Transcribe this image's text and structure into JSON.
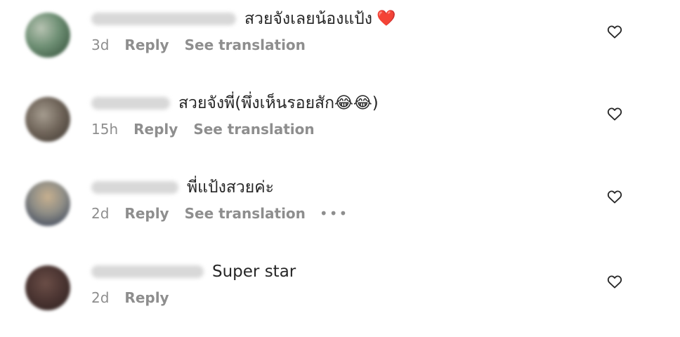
{
  "comments": [
    {
      "username_redacted": true,
      "text": "สวยจังเลยน้องแป้ง",
      "emoji": "❤️",
      "time": "3d",
      "reply": "Reply",
      "translation": "See translation",
      "has_more": false
    },
    {
      "username_redacted": true,
      "text": "สวยจังพี่(พึ่งเห็นรอยสัก😂😂)",
      "emoji": "",
      "time": "15h",
      "reply": "Reply",
      "translation": "See translation",
      "has_more": false
    },
    {
      "username_redacted": true,
      "text": "พี่แป้งสวยค่ะ",
      "emoji": "",
      "time": "2d",
      "reply": "Reply",
      "translation": "See translation",
      "more": "•••",
      "has_more": true
    },
    {
      "username_redacted": true,
      "text": "Super star",
      "emoji": "",
      "time": "2d",
      "reply": "Reply",
      "has_more": false
    }
  ],
  "icons": {
    "like": "heart-outline-icon",
    "more": "more-dots-icon"
  },
  "colors": {
    "text": "#262626",
    "muted": "#8e8e8e",
    "heart_red": "#ed4956"
  }
}
